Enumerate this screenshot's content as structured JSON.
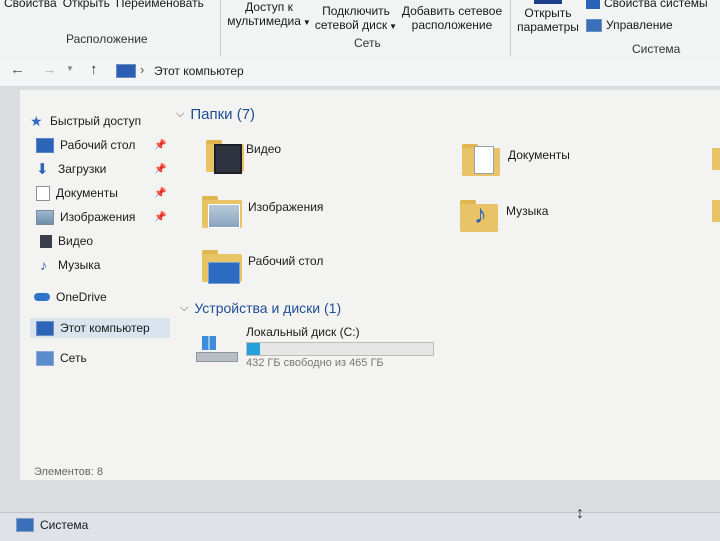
{
  "ribbon": {
    "top_items": [
      "Свойства",
      "Открыть",
      "Переименовать"
    ],
    "media_access": [
      "Доступ к",
      "мультимедиа"
    ],
    "map_drive": [
      "Подключить",
      "сетевой диск"
    ],
    "add_location": [
      "Добавить сетевое",
      "расположение"
    ],
    "open_settings": [
      "Открыть",
      "параметры"
    ],
    "system_props": "Свойства системы",
    "manage": "Управление",
    "groups": {
      "location": "Расположение",
      "network": "Сеть",
      "system": "Система"
    }
  },
  "navbar": {
    "back_icon": "←",
    "forward_icon": "→",
    "up_icon": "↑",
    "path_sep": "›",
    "path": "Этот компьютер"
  },
  "sidebar": {
    "quick_access": "Быстрый доступ",
    "items": [
      {
        "label": "Рабочий стол",
        "icon": "desktop-icon",
        "pinned": true
      },
      {
        "label": "Загрузки",
        "icon": "downloads-icon",
        "pinned": true
      },
      {
        "label": "Документы",
        "icon": "documents-icon",
        "pinned": true
      },
      {
        "label": "Изображения",
        "icon": "pictures-icon",
        "pinned": true
      },
      {
        "label": "Видео",
        "icon": "video-icon",
        "pinned": false
      },
      {
        "label": "Музыка",
        "icon": "music-icon",
        "pinned": false
      }
    ],
    "onedrive": "OneDrive",
    "this_pc": "Этот компьютер",
    "network": "Сеть"
  },
  "folders_section": {
    "title": "Папки (7)",
    "folders": [
      "Видео",
      "Документы",
      "Изображения",
      "Музыка",
      "Рабочий стол"
    ]
  },
  "devices_section": {
    "title": "Устройства и диски (1)",
    "drive": {
      "name": "Локальный диск (C:)",
      "free_text": "432 ГБ свободно из 465 ГБ",
      "used_fraction": 0.071
    }
  },
  "status": {
    "items_count": "Элементов: 8"
  },
  "taskbar": {
    "item": "Система"
  },
  "colors": {
    "accent": "#1f4e96",
    "folder": "#e8c467",
    "selection": "#d9e4ee"
  }
}
